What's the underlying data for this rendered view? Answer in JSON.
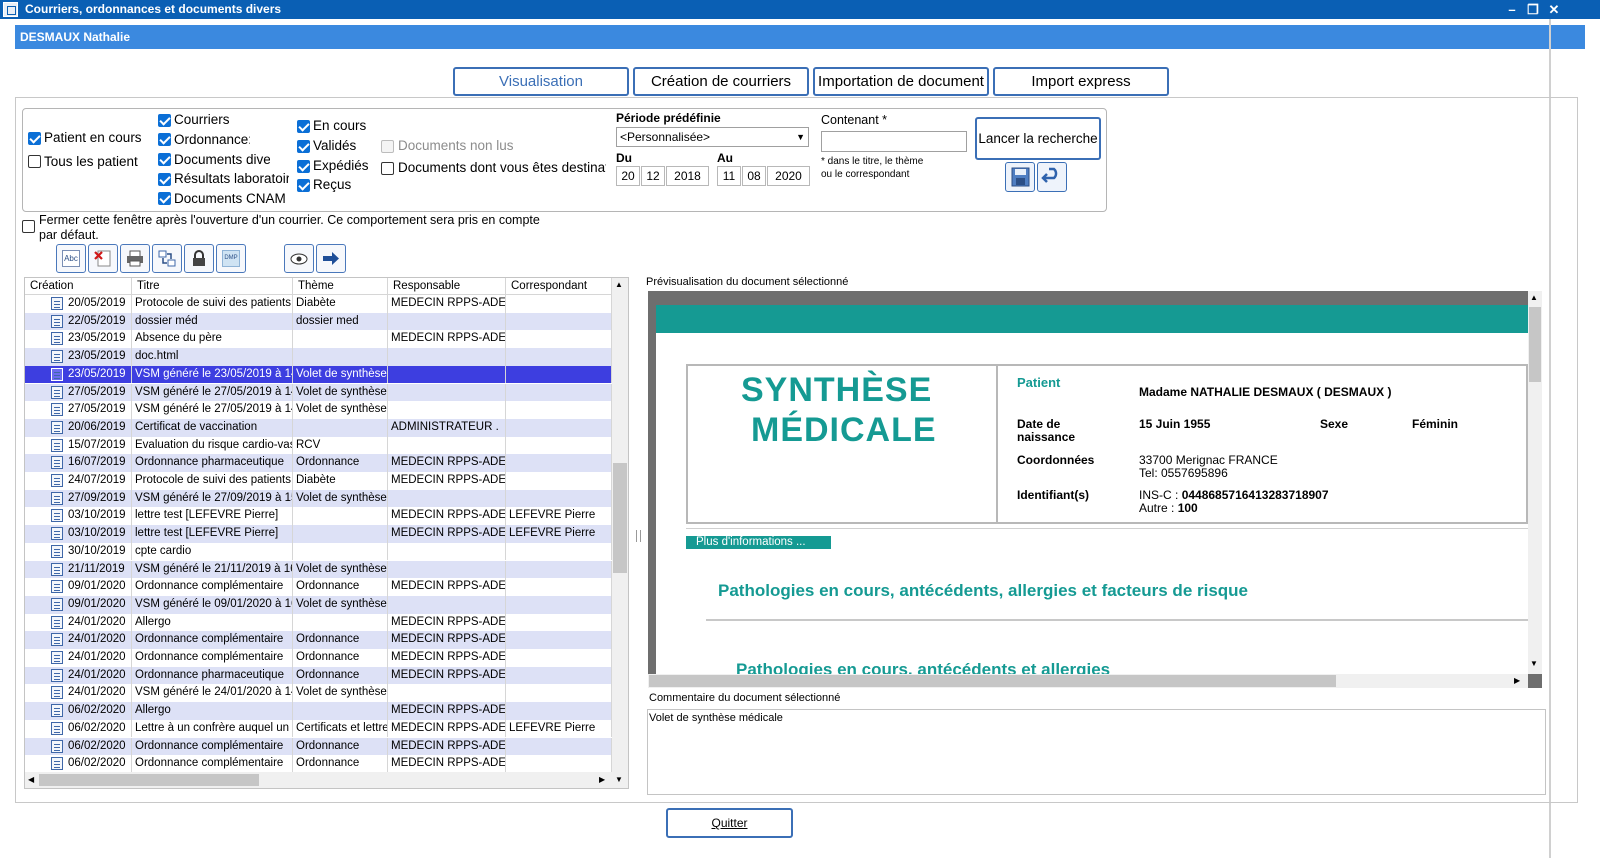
{
  "window": {
    "title": "Courriers, ordonnances et documents divers"
  },
  "patient": {
    "name": "DESMAUX Nathalie"
  },
  "tabs": [
    "Visualisation",
    "Création de courriers",
    "Importation de document",
    "Import express"
  ],
  "filters": {
    "scope": [
      "Patient en cours",
      "Tous les patient"
    ],
    "types": [
      "Courriers",
      "Ordonnance:",
      "Documents dive",
      "Résultats laboratoir",
      "Documents CNAM"
    ],
    "states": [
      "En cours",
      "Validés",
      "Expédiés",
      "Reçus"
    ],
    "extra": [
      "Documents non lus",
      "Documents dont vous êtes destinata"
    ],
    "period_label": "Période prédéfinie",
    "period_value": "<Personnalisée>",
    "du_label": "Du",
    "au_label": "Au",
    "du": [
      "20",
      "12",
      "2018"
    ],
    "au": [
      "11",
      "08",
      "2020"
    ],
    "contenant_label": "Contenant *",
    "contenant_value": "",
    "contenant_hint_1": "* dans le titre, le thème",
    "contenant_hint_2": "ou le correspondant",
    "search_button": "Lancer la recherche"
  },
  "close_option_1": "Fermer cette fenêtre après l'ouverture d'un courrier. Ce comportement sera pris en compte",
  "close_option_2": "par défaut.",
  "toolbar": {
    "abc_label": "Abc",
    "dmp_label": "DMP",
    "icons": [
      "spellcheck-icon",
      "delete-icon",
      "print-icon",
      "transfer-icon",
      "lock-icon",
      "dmp-icon",
      "eye-icon",
      "arrow-right-icon"
    ]
  },
  "table": {
    "columns": [
      "Création",
      "Titre",
      "Thème",
      "Responsable",
      "Correspondant"
    ],
    "rows": [
      [
        "20/05/2019",
        "Protocole de suivi des patients di..",
        "Diabète",
        "MEDECIN RPPS-ADELI",
        ""
      ],
      [
        "22/05/2019",
        "dossier méd",
        "dossier med",
        "",
        ""
      ],
      [
        "23/05/2019",
        "Absence du père",
        "",
        "MEDECIN RPPS-ADE...",
        ""
      ],
      [
        "23/05/2019",
        "doc.html",
        "",
        "",
        ""
      ],
      [
        "23/05/2019",
        "VSM généré le 23/05/2019 à 14..",
        "Volet de synthèse ..",
        "",
        ""
      ],
      [
        "27/05/2019",
        "VSM généré le 27/05/2019 à 14..",
        "Volet de synthèse ..",
        "",
        ""
      ],
      [
        "27/05/2019",
        "VSM généré le 27/05/2019 à 14..",
        "Volet de synthèse ..",
        "",
        ""
      ],
      [
        "20/06/2019",
        "Certificat de vaccination",
        "",
        "ADMINISTRATEUR .",
        ""
      ],
      [
        "15/07/2019",
        "Evaluation du risque cardio-vasc..",
        "RCV",
        "",
        ""
      ],
      [
        "16/07/2019",
        "Ordonnance pharmaceutique",
        "Ordonnance",
        "MEDECIN RPPS-ADE...",
        ""
      ],
      [
        "24/07/2019",
        "Protocole de suivi des patients di..",
        "Diabète",
        "MEDECIN RPPS-ADELI",
        ""
      ],
      [
        "27/09/2019",
        "VSM généré le 27/09/2019 à 15..",
        "Volet de synthèse ..",
        "",
        ""
      ],
      [
        "03/10/2019",
        "lettre test [LEFEVRE  Pierre]",
        "",
        "MEDECIN RPPS-ADE...",
        "LEFEVRE  Pierre"
      ],
      [
        "03/10/2019",
        "lettre test [LEFEVRE  Pierre]",
        "",
        "MEDECIN RPPS-ADE...",
        "LEFEVRE  Pierre"
      ],
      [
        "30/10/2019",
        "cpte cardio",
        "",
        "",
        ""
      ],
      [
        "21/11/2019",
        "VSM généré le 21/11/2019 à 16..",
        "Volet de synthèse ..",
        "",
        ""
      ],
      [
        "09/01/2020",
        "Ordonnance complémentaire",
        "Ordonnance",
        "MEDECIN RPPS-ADE...",
        ""
      ],
      [
        "09/01/2020",
        "VSM généré le 09/01/2020 à 16..",
        "Volet de synthèse ..",
        "",
        ""
      ],
      [
        "24/01/2020",
        "Allergo",
        "",
        "MEDECIN RPPS-ADE...",
        ""
      ],
      [
        "24/01/2020",
        "Ordonnance complémentaire",
        "Ordonnance",
        "MEDECIN RPPS-ADE...",
        ""
      ],
      [
        "24/01/2020",
        "Ordonnance complémentaire",
        "Ordonnance",
        "MEDECIN RPPS-ADE...",
        ""
      ],
      [
        "24/01/2020",
        "Ordonnance pharmaceutique",
        "Ordonnance",
        "MEDECIN RPPS-ADE...",
        ""
      ],
      [
        "24/01/2020",
        "VSM généré le 24/01/2020 à 14..",
        "Volet de synthèse ..",
        "",
        ""
      ],
      [
        "06/02/2020",
        "Allergo",
        "",
        "MEDECIN RPPS-ADE...",
        ""
      ],
      [
        "06/02/2020",
        "Lettre à un confrère auquel un p..",
        "Certificats et lettre...",
        "MEDECIN RPPS-ADE...",
        "LEFEVRE  Pierre"
      ],
      [
        "06/02/2020",
        "Ordonnance complémentaire",
        "Ordonnance",
        "MEDECIN RPPS-ADE...",
        ""
      ],
      [
        "06/02/2020",
        "Ordonnance complémentaire",
        "Ordonnance",
        "MEDECIN RPPS-ADE...",
        ""
      ]
    ]
  },
  "preview": {
    "label": "Prévisualisation du document sélectionné",
    "title_line1": "SYNTHÈSE",
    "title_line2": "MÉDICALE",
    "patient_label": "Patient",
    "patient_value": "Madame NATHALIE DESMAUX ( DESMAUX )",
    "dob_label_1": "Date de",
    "dob_label_2": "naissance",
    "dob_value": "15 Juin 1955",
    "sexe_label": "Sexe",
    "sexe_value": "Féminin",
    "coord_label": "Coordonnées",
    "coord_line1": "33700 Merignac FRANCE",
    "coord_line2": "Tel: 0557695896",
    "ident_label": "Identifiant(s)",
    "insc_label": "INS-C :",
    "insc_value": "0448685716413283718907",
    "autre_label": "Autre :",
    "autre_value": "100",
    "more_info": "Plus d'informations ...",
    "section1": "Pathologies en cours, antécédents, allergies et facteurs de risque",
    "section2": "Pathologies en cours, antécédents et allergies"
  },
  "comment": {
    "label": "Commentaire du document sélectionné",
    "value": "Volet de synthèse médicale"
  },
  "quit_button": "Quitter",
  "colors": {
    "titlebar": "#0a5fb4",
    "patientbar": "#3b89df",
    "accent": "#3b6fb6",
    "teal": "#159a93",
    "selected_row": "#3d3ee0",
    "alt_row": "#dde1f6"
  }
}
